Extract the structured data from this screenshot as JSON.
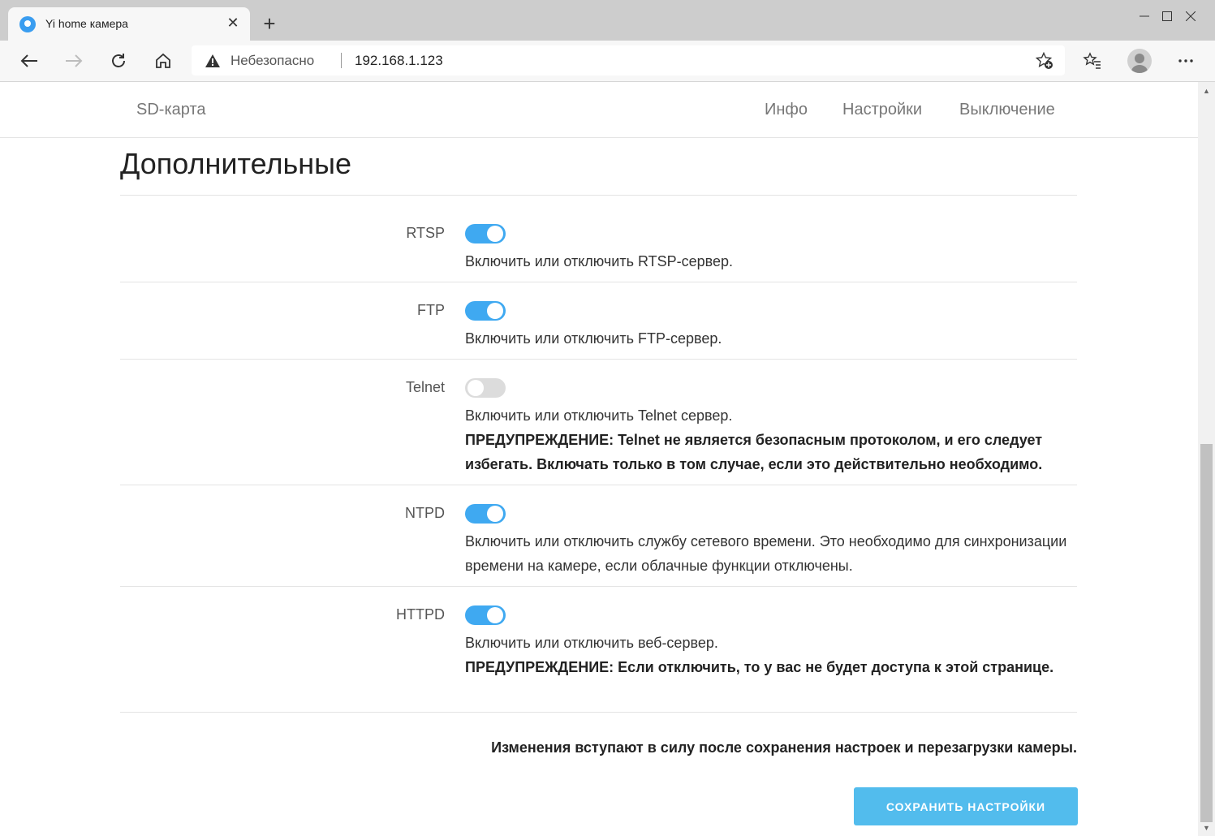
{
  "browser": {
    "tab_title": "Yi home камера",
    "security_label": "Небезопасно",
    "url": "192.168.1.123"
  },
  "nav": {
    "sd_card": "SD-карта",
    "info": "Инфо",
    "settings": "Настройки",
    "shutdown": "Выключение"
  },
  "page": {
    "title": "Дополнительные",
    "note": "Изменения вступают в силу после сохранения настроек и перезагрузки камеры.",
    "save_label": "СОХРАНИТЬ НАСТРОЙКИ"
  },
  "settings": {
    "rtsp": {
      "label": "RTSP",
      "enabled": true,
      "description": "Включить или отключить RTSP-сервер."
    },
    "ftp": {
      "label": "FTP",
      "enabled": true,
      "description": "Включить или отключить FTP-сервер."
    },
    "telnet": {
      "label": "Telnet",
      "enabled": false,
      "description": "Включить или отключить Telnet сервер.",
      "warning": "ПРЕДУПРЕЖДЕНИЕ: Telnet не является безопасным протоколом, и его следует избегать. Включать только в том случае, если это действительно необходимо."
    },
    "ntpd": {
      "label": "NTPD",
      "enabled": true,
      "description": "Включить или отключить службу сетевого времени. Это необходимо для синхронизации времени на камере, если облачные функции отключены."
    },
    "httpd": {
      "label": "HTTPD",
      "enabled": true,
      "description": "Включить или отключить веб-сервер.",
      "warning": "ПРЕДУПРЕЖДЕНИЕ: Если отключить, то у вас не будет доступа к этой странице."
    }
  },
  "colors": {
    "toggle_on": "#3fa9f1",
    "toggle_off": "#dcdcdc",
    "save_button": "#52bced"
  }
}
